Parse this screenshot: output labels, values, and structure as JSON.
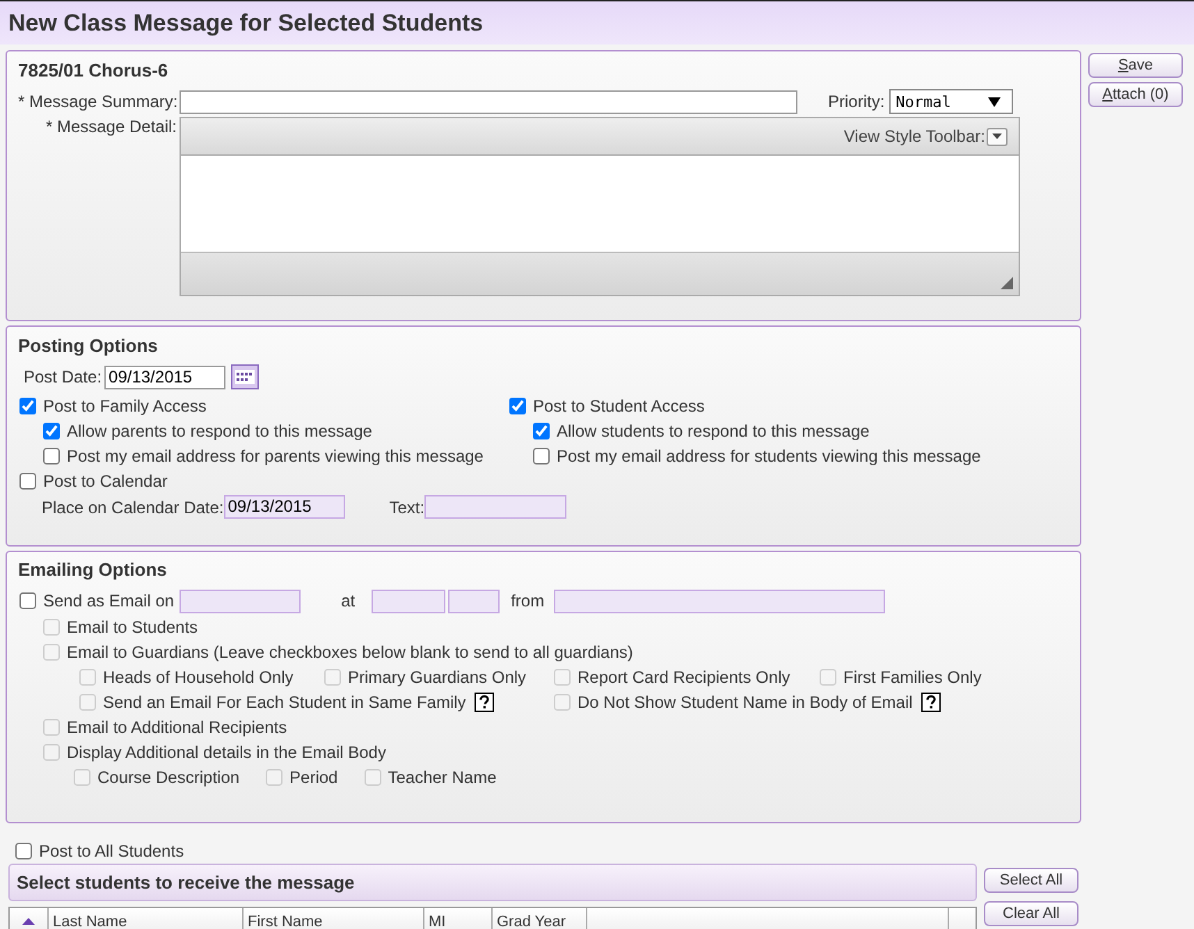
{
  "title": "New Class Message for Selected Students",
  "buttons": [
    {
      "label": "Save"
    },
    {
      "label": "Attach (0)"
    }
  ],
  "message": {
    "class_name": "7825/01 Chorus-6",
    "summary_label": "* Message Summary:",
    "priority_label": "Priority:",
    "priority": "Normal",
    "detail_label": "* Message Detail:",
    "toolbar_label": "View Style Toolbar:"
  },
  "posting": {
    "heading": "Posting Options",
    "post_date_label": "Post Date:",
    "post_date": "09/13/2015",
    "columns": [
      {
        "label": "Post to Family Access",
        "checked": true,
        "children": [
          {
            "label": "Allow parents to respond to this message",
            "checked": true
          },
          {
            "label": "Post my email address for parents viewing this message",
            "checked": false
          }
        ]
      },
      {
        "label": "Post to Student Access",
        "checked": true,
        "children": [
          {
            "label": "Allow students to respond to this message",
            "checked": true
          },
          {
            "label": "Post my email address for students viewing this message",
            "checked": false
          }
        ]
      }
    ],
    "calendar": {
      "label": "Post to Calendar",
      "checked": false,
      "date_label": "Place on Calendar Date:",
      "date": "09/13/2015",
      "text_label": "Text:"
    }
  },
  "emailing": {
    "heading": "Emailing Options",
    "send": {
      "label": "Send as Email on",
      "checked": false,
      "disabled": false
    },
    "at_label": "at",
    "from_label": "from",
    "options": [
      {
        "label": "Email to Students",
        "checked": false,
        "disabled": true
      },
      {
        "label": "Email to Guardians (Leave checkboxes below blank to send to all guardians)",
        "checked": false,
        "disabled": true,
        "columns": [
          [
            {
              "label": "Heads of Household Only",
              "checked": false,
              "disabled": true
            },
            {
              "label": "Send an Email For Each Student in Same Family",
              "checked": false,
              "disabled": true,
              "help": true
            }
          ],
          [
            {
              "label": "Primary Guardians Only",
              "checked": false,
              "disabled": true
            }
          ],
          [
            {
              "label": "Report Card Recipients Only",
              "checked": false,
              "disabled": true
            },
            {
              "label": "Do Not Show Student Name in Body of Email",
              "checked": false,
              "disabled": true,
              "help": true
            }
          ],
          [
            {
              "label": "First Families Only",
              "checked": false,
              "disabled": true
            }
          ]
        ]
      },
      {
        "label": "Email to Additional Recipients",
        "checked": false,
        "disabled": true
      },
      {
        "label": "Display Additional details in the Email Body",
        "checked": false,
        "disabled": true,
        "children": [
          {
            "label": "Course Description",
            "checked": false,
            "disabled": true
          },
          {
            "label": "Period",
            "checked": false,
            "disabled": true
          },
          {
            "label": "Teacher Name",
            "checked": false,
            "disabled": true
          }
        ]
      }
    ]
  },
  "post_all": {
    "label": "Post to All Students",
    "checked": false
  },
  "students": {
    "heading": "Select students to receive the message",
    "columns": [
      "Last Name",
      "First Name",
      "MI",
      "Grad Year"
    ],
    "buttons": [
      {
        "label": "Select All"
      },
      {
        "label": "Clear All"
      }
    ]
  }
}
